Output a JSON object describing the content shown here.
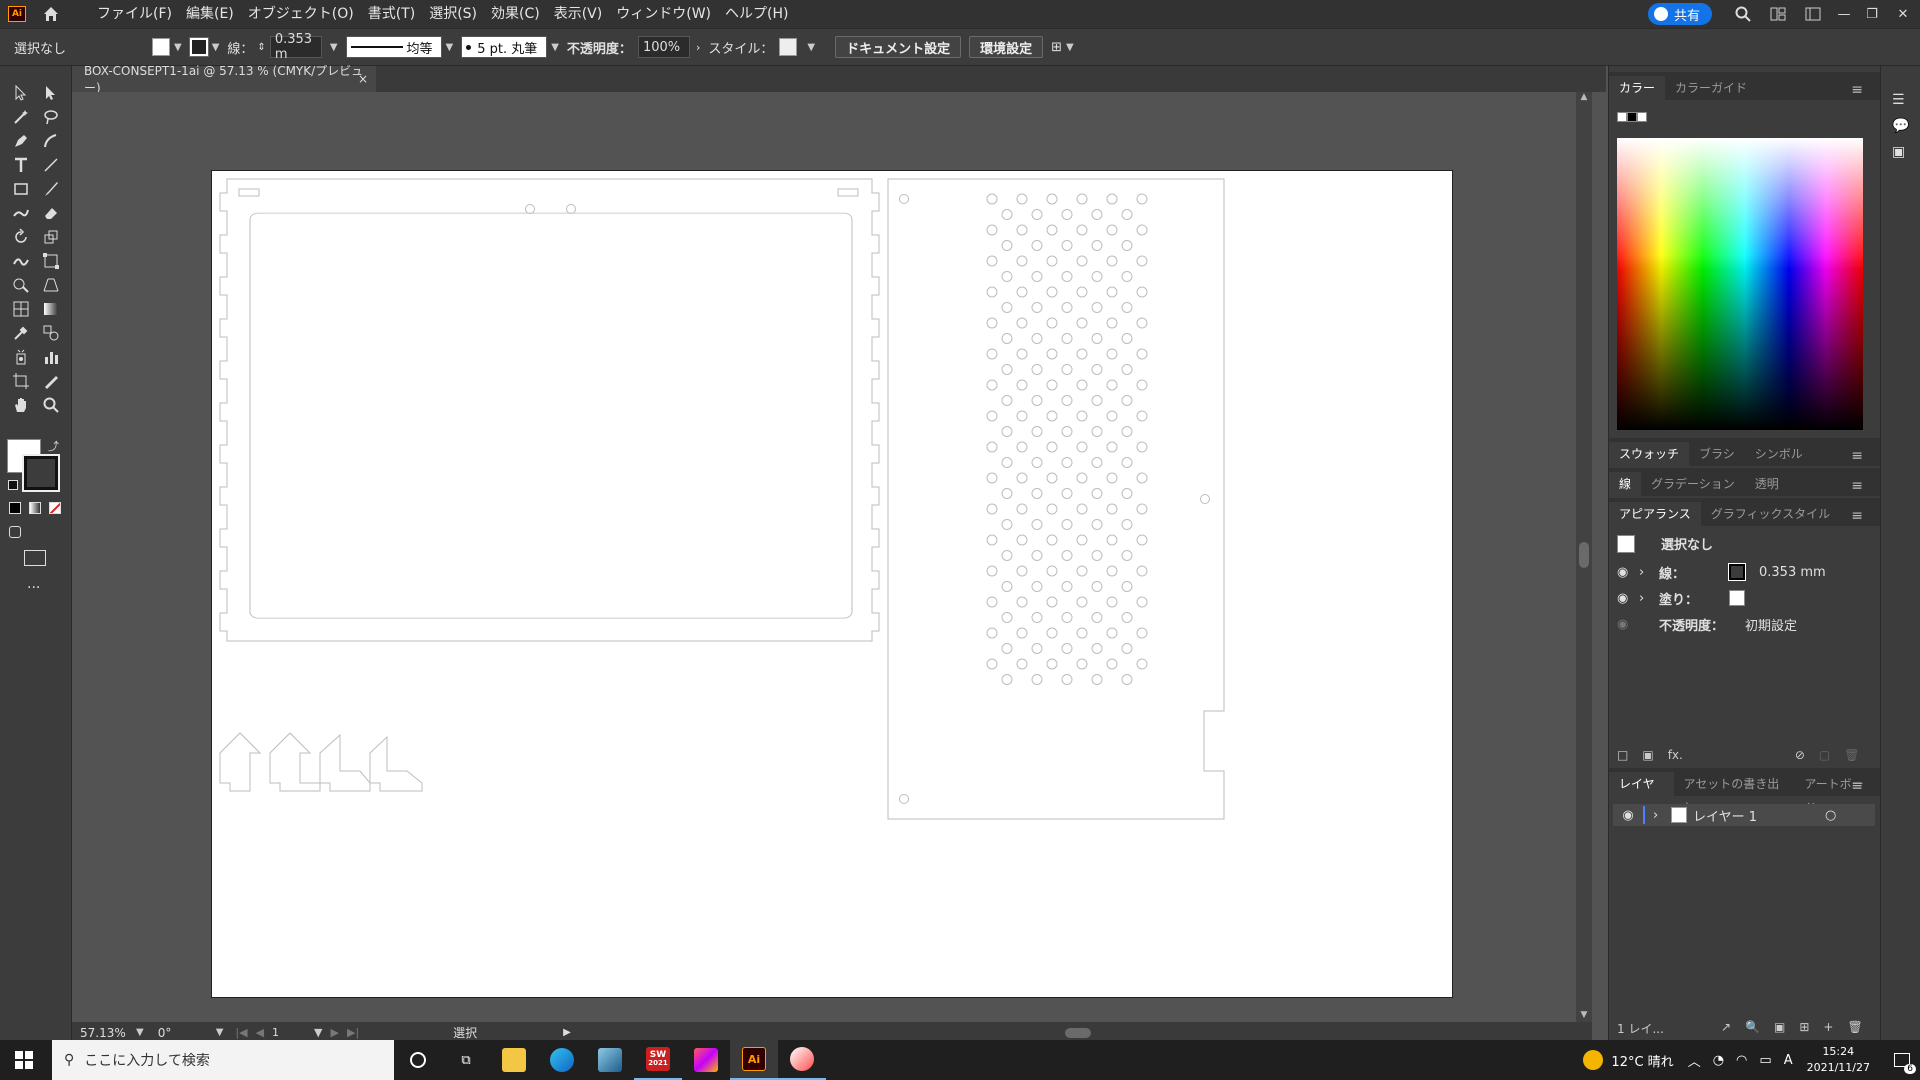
{
  "app": {
    "logo_text": "Ai",
    "menus": [
      "ファイル(F)",
      "編集(E)",
      "オブジェクト(O)",
      "書式(T)",
      "選択(S)",
      "効果(C)",
      "表示(V)",
      "ウィンドウ(W)",
      "ヘルプ(H)"
    ],
    "share_label": "共有",
    "accent": "#1473e6"
  },
  "controlbar": {
    "selection": "選択なし",
    "stroke_label": "線：",
    "stroke_value": "0.353 m",
    "stroke_style": "均等",
    "brush": "5 pt. 丸筆",
    "opacity_label": "不透明度：",
    "opacity_value": "100%",
    "style_label": "スタイル：",
    "doc_settings": "ドキュメント設定",
    "prefs": "環境設定"
  },
  "document": {
    "tab_title": "BOX-CONSEPT1-1ai @ 57.13 % (CMYK/プレビュー)",
    "close": "×"
  },
  "status": {
    "zoom": "57.13%",
    "rotation": "0°",
    "artboard": "1",
    "mode": "選択"
  },
  "panels": {
    "color_tabs": [
      "カラー",
      "カラーガイド"
    ],
    "swatch_tabs": [
      "スウォッチ",
      "ブラシ",
      "シンボル"
    ],
    "stroke_tabs": [
      "線",
      "グラデーション",
      "透明"
    ],
    "appearance_tabs": [
      "アピアランス",
      "グラフィックスタイル"
    ],
    "appearance": {
      "title": "選択なし",
      "stroke_label": "線：",
      "stroke_value": "0.353 mm",
      "fill_label": "塗り：",
      "opacity_label": "不透明度：",
      "opacity_value": "初期設定",
      "fx": "fx."
    },
    "layer_tabs": [
      "レイヤー",
      "アセットの書き出し",
      "アートボード"
    ],
    "layer_name": "レイヤー 1",
    "layer_count": "1 レイ..."
  },
  "taskbar": {
    "search_placeholder": "ここに入力して検索",
    "weather": "12°C 晴れ",
    "time": "15:24",
    "date": "2021/11/27",
    "ime": "A",
    "notifications": "6",
    "sw_label": "SW",
    "sw_year": "2021",
    "ai_label": "Ai"
  }
}
